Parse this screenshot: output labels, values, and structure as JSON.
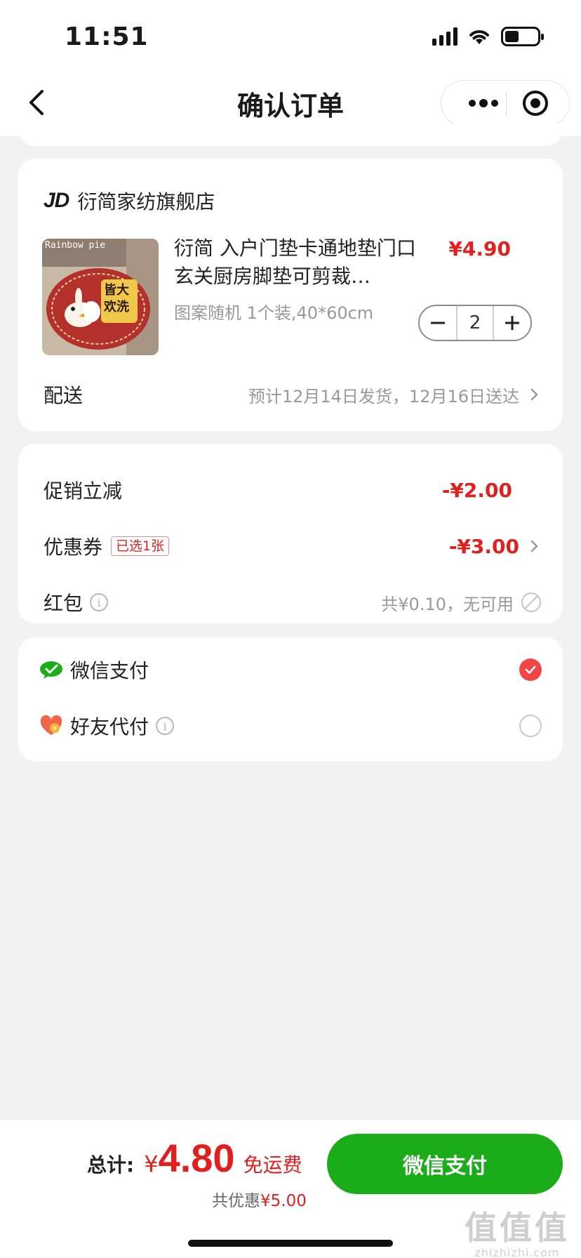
{
  "status_bar": {
    "time": "11:51"
  },
  "nav": {
    "title": "确认订单"
  },
  "shop": {
    "logo_text": "JD",
    "name": "衍简家纺旗舰店",
    "product": {
      "title": "衍简 入户门垫卡通地垫门口玄关厨房脚垫可剪裁…",
      "spec": "图案随机 1个装,40*60cm",
      "price": "¥4.90",
      "quantity": "2",
      "image_brand_text": "Rainbow pie",
      "image_mat_text": "皆大欢洗"
    },
    "delivery": {
      "label": "配送",
      "value": "预计12月14日发货，12月16日送达"
    }
  },
  "discounts": {
    "promo": {
      "label": "促销立减",
      "value": "-¥2.00"
    },
    "coupon": {
      "label": "优惠券",
      "tag": "已选1张",
      "value": "-¥3.00"
    },
    "red_packet": {
      "label": "红包",
      "value": "共¥0.10，无可用"
    }
  },
  "payment": {
    "options": [
      {
        "label": "微信支付",
        "icon": "wechat-pay-icon",
        "selected": true
      },
      {
        "label": "好友代付",
        "icon": "friend-pay-icon",
        "selected": false
      }
    ]
  },
  "footer": {
    "total_label": "总计:",
    "currency": "¥",
    "total_amount": "4.80",
    "free_shipping": "免运费",
    "saving_prefix": "共优惠",
    "saving_amount": "¥5.00",
    "pay_button": "微信支付"
  },
  "watermark": {
    "big": "值值值",
    "small": "zhizhizhi.com"
  },
  "colors": {
    "accent_red": "#e0201f",
    "wechat_green": "#1aad19",
    "checked_red": "#f04646",
    "background": "#f2f2f2"
  }
}
